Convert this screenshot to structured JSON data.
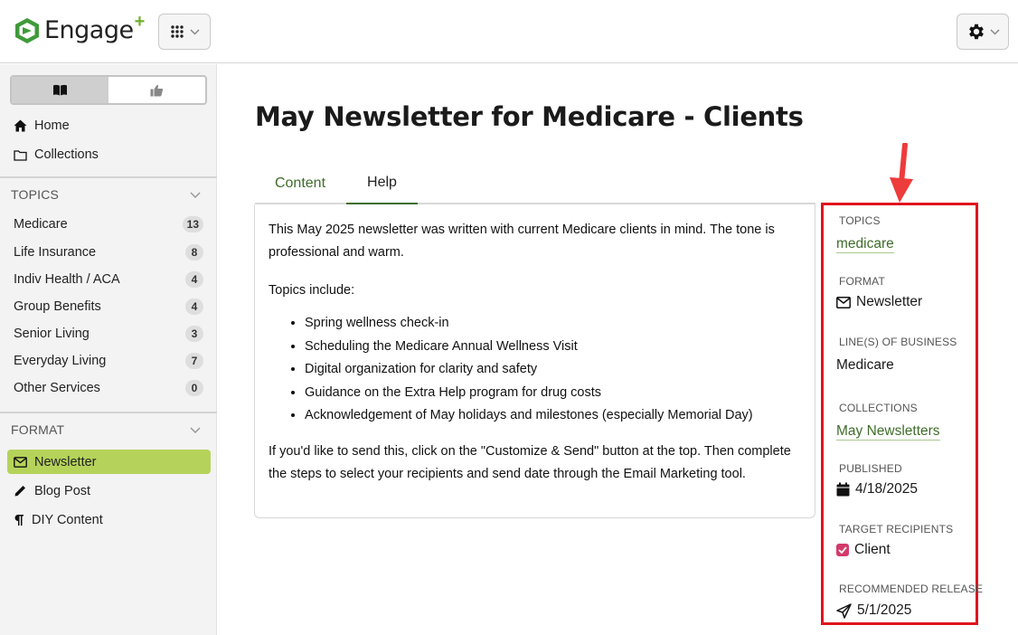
{
  "header": {
    "logo_text": "Engage",
    "logo_plus": "+",
    "icons": {
      "apps": "grid-icon",
      "settings": "gear-icon"
    }
  },
  "sidebar": {
    "view_icons": [
      "book-icon",
      "thumbs-up-icon"
    ],
    "links": [
      {
        "label": "Home",
        "icon": "home-icon"
      },
      {
        "label": "Collections",
        "icon": "folder-icon"
      }
    ],
    "topics_heading": "TOPICS",
    "topics": [
      {
        "label": "Medicare",
        "count": "13"
      },
      {
        "label": "Life Insurance",
        "count": "8"
      },
      {
        "label": "Indiv Health / ACA",
        "count": "4"
      },
      {
        "label": "Group Benefits",
        "count": "4"
      },
      {
        "label": "Senior Living",
        "count": "3"
      },
      {
        "label": "Everyday Living",
        "count": "7"
      },
      {
        "label": "Other Services",
        "count": "0"
      }
    ],
    "format_heading": "FORMAT",
    "formats": [
      {
        "label": "Newsletter",
        "icon": "envelope-icon",
        "active": true
      },
      {
        "label": "Blog Post",
        "icon": "pencil-icon",
        "active": false
      },
      {
        "label": "DIY Content",
        "icon": "pilcrow-icon",
        "active": false
      }
    ]
  },
  "main": {
    "title": "May Newsletter for Medicare - Clients",
    "tabs": [
      {
        "label": "Content",
        "active": false
      },
      {
        "label": "Help",
        "active": true
      }
    ],
    "help": {
      "intro": "This May 2025 newsletter was written with current Medicare clients in mind. The tone is professional and warm.",
      "topics_intro": "Topics include:",
      "bullets": [
        "Spring wellness check-in",
        "Scheduling the Medicare Annual Wellness Visit",
        "Digital organization for clarity and safety",
        "Guidance on the Extra Help program for drug costs",
        "Acknowledgement of May holidays and milestones (especially Memorial Day)"
      ],
      "outro": "If you'd like to send this, click on the \"Customize & Send\" button at the top. Then complete the steps to select your recipients and send date through the Email Marketing tool."
    }
  },
  "meta": {
    "topics_label": "TOPICS",
    "topics_value": "medicare",
    "format_label": "FORMAT",
    "format_value": "Newsletter",
    "lob_label": "LINE(S) OF BUSINESS",
    "lob_value": "Medicare",
    "collections_label": "COLLECTIONS",
    "collections_value": "May Newsletters",
    "published_label": "PUBLISHED",
    "published_value": "4/18/2025",
    "target_label": "TARGET RECIPIENTS",
    "target_value": "Client",
    "release_label": "RECOMMENDED RELEASE",
    "release_value": "5/1/2025"
  },
  "colors": {
    "brand_green": "#3f6d2a",
    "active_format": "#b5d35a",
    "highlight_red": "#e0141e",
    "arrow_red": "#ee3b3b",
    "check_pink": "#d23a6a"
  }
}
